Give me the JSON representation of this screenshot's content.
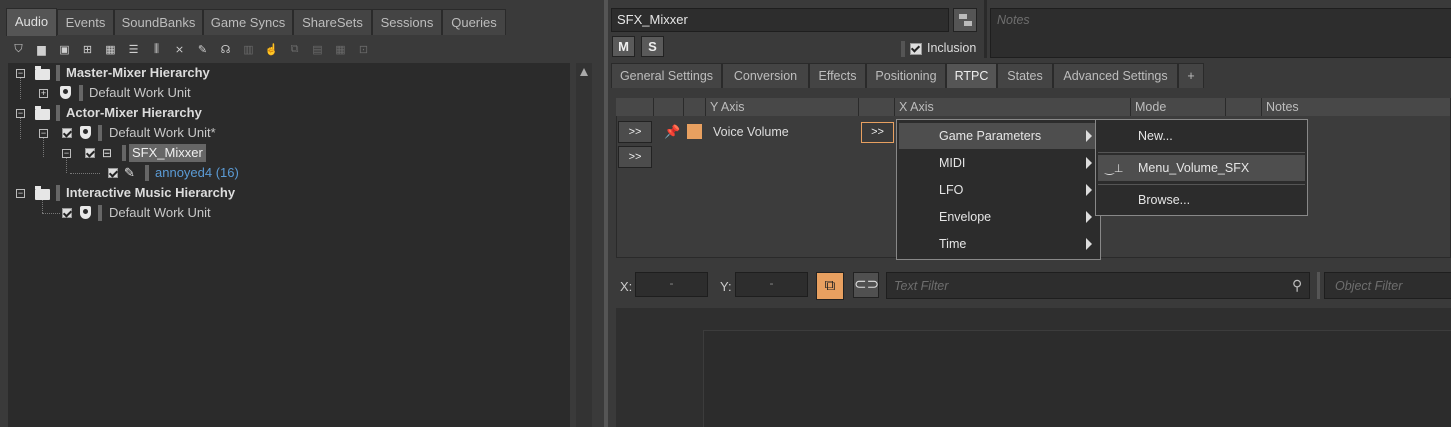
{
  "left_panel": {
    "tabs": [
      "Audio",
      "Events",
      "SoundBanks",
      "Game Syncs",
      "ShareSets",
      "Sessions",
      "Queries"
    ],
    "active_tab": "Audio",
    "tree": {
      "master_mixer": "Master-Mixer Hierarchy",
      "master_default_wu": "Default Work Unit",
      "actor_mixer": "Actor-Mixer Hierarchy",
      "actor_default_wu": "Default Work Unit*",
      "sfx_mixer": "SFX_Mixxer",
      "child_sound": "annoyed4 (16)",
      "interactive_music": "Interactive Music Hierarchy",
      "music_default_wu": "Default Work Unit"
    }
  },
  "right_panel": {
    "object_name": "SFX_Mixxer",
    "notes_placeholder": "Notes",
    "mute_label": "M",
    "solo_label": "S",
    "inclusion_label": "Inclusion",
    "tabs": [
      "General Settings",
      "Conversion",
      "Effects",
      "Positioning",
      "RTPC",
      "States",
      "Advanced Settings",
      "+"
    ],
    "active_tab": "RTPC",
    "rtpc_table": {
      "headers": [
        "Y Axis",
        "X Axis",
        "Mode",
        "Notes"
      ],
      "row_y_axis": "Voice Volume",
      "expand_label": ">>",
      "accent_color": "#e8a060"
    },
    "context_menu": {
      "items": [
        "Game Parameters",
        "MIDI",
        "LFO",
        "Envelope",
        "Time"
      ],
      "highlighted": "Game Parameters"
    },
    "submenu": {
      "items": [
        "New...",
        "Menu_Volume_SFX",
        "Browse..."
      ],
      "highlighted": "Menu_Volume_SFX"
    },
    "graph_toolbar": {
      "x_label": "X:",
      "x_value": "-",
      "y_label": "Y:",
      "y_value": "-",
      "text_filter_placeholder": "Text Filter",
      "object_filter_placeholder": "Object Filter"
    }
  }
}
